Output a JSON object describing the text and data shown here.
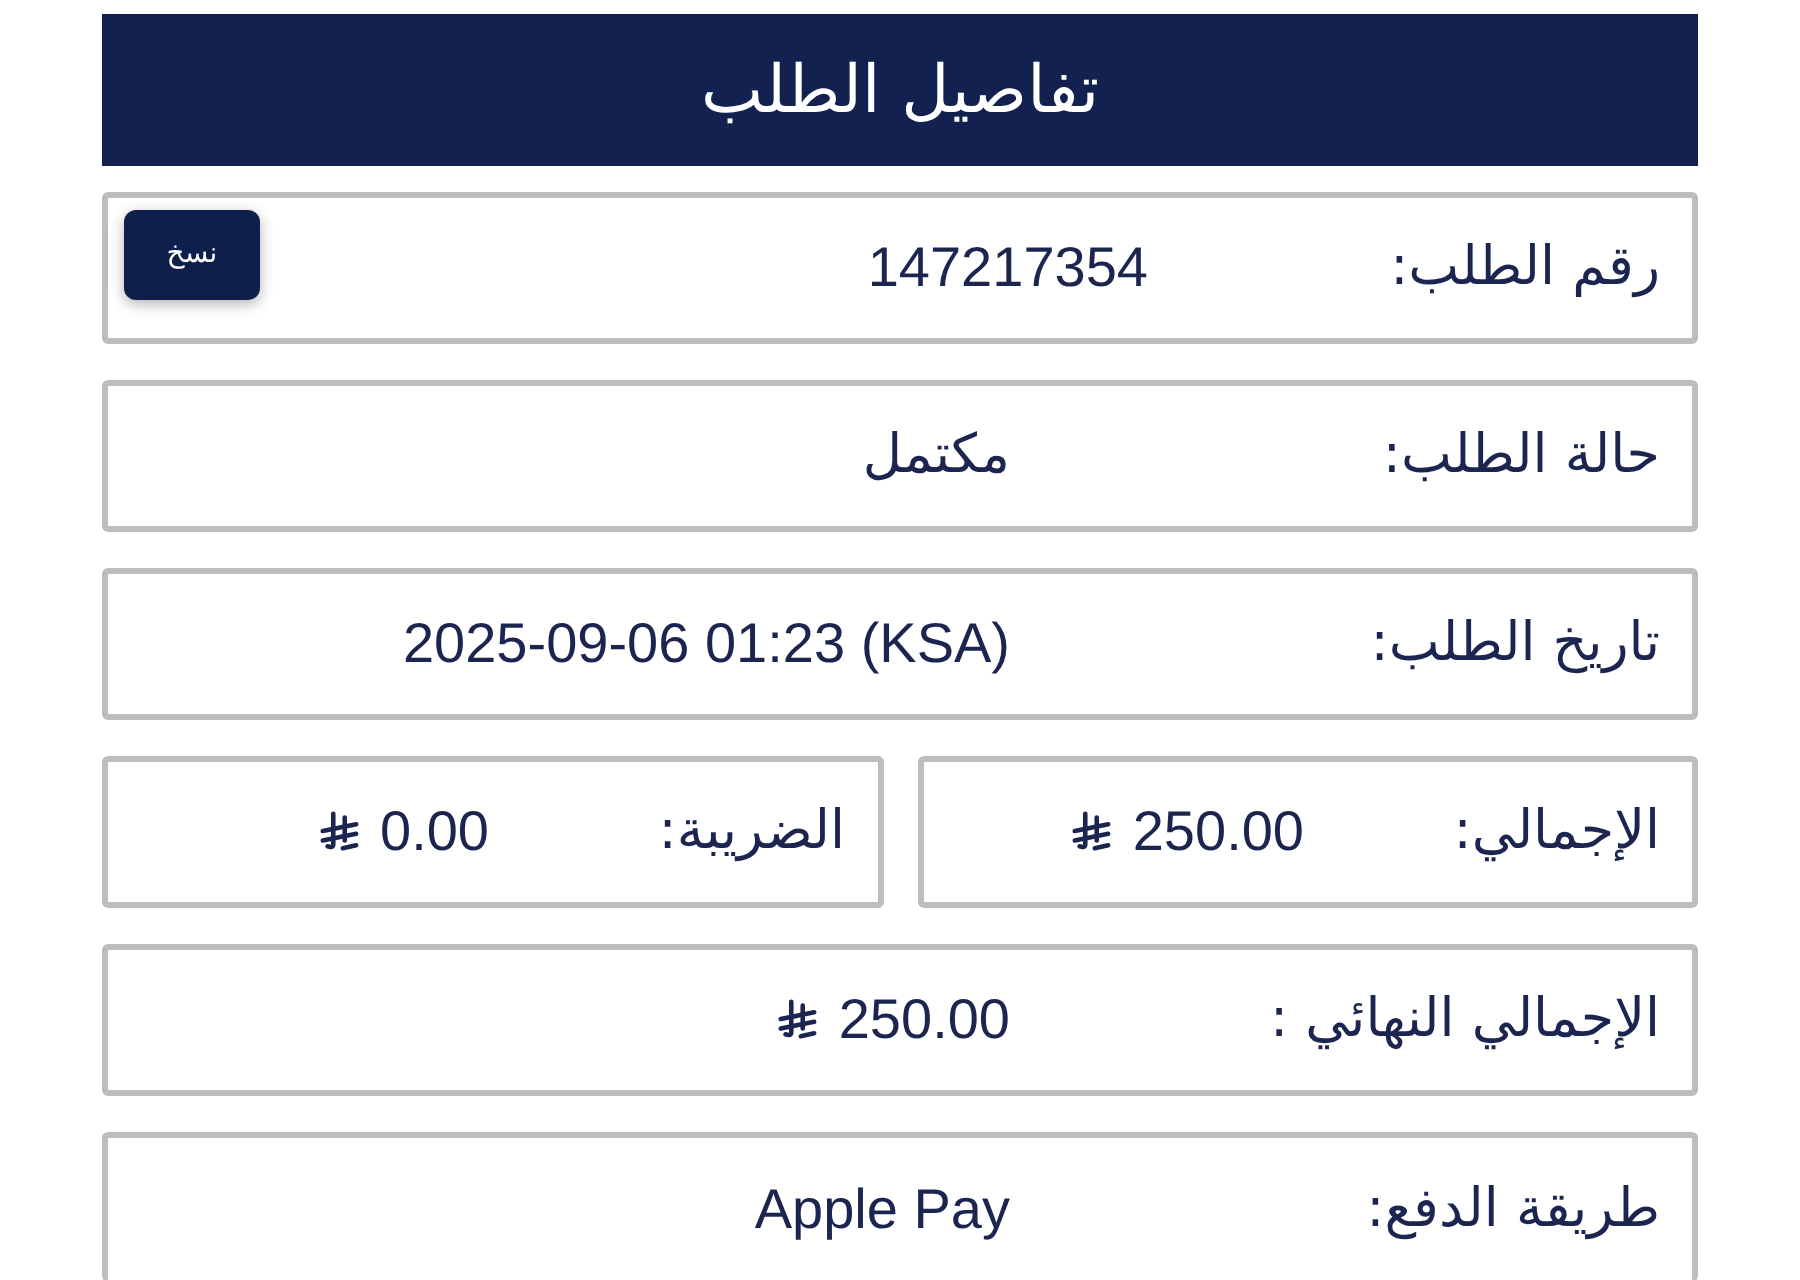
{
  "header": {
    "title": "تفاصيل الطلب"
  },
  "rows": [
    {
      "kind": "copy",
      "label": "رقم الطلب:",
      "value": "147217354",
      "currency": false,
      "button": "نسخ"
    },
    {
      "kind": "field",
      "label": "حالة الطلب:",
      "value": "مكتمل",
      "currency": false
    },
    {
      "kind": "field",
      "label": "تاريخ الطلب:",
      "value": "2025-09-06 01:23 (KSA)",
      "currency": false
    },
    {
      "kind": "split",
      "cells": [
        {
          "label": "الإجمالي:",
          "value": "250.00",
          "currency": true
        },
        {
          "label": "الضريبة:",
          "value": "0.00",
          "currency": true
        }
      ]
    },
    {
      "kind": "field",
      "label": "الإجمالي النهائي :",
      "value": "250.00",
      "currency": true
    },
    {
      "kind": "field",
      "label": "طريقة الدفع:",
      "value": "Apple Pay",
      "currency": false
    }
  ]
}
